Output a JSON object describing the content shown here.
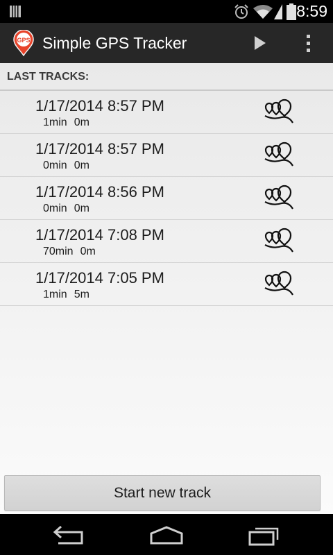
{
  "status_bar": {
    "time": "8:59",
    "icons": [
      "storage-icon",
      "alarm-icon",
      "wifi-icon",
      "signal-icon",
      "battery-icon"
    ]
  },
  "action_bar": {
    "app_icon": "gps-pin-icon",
    "app_icon_text": "GPS",
    "title": "Simple GPS Tracker",
    "actions": [
      "play-icon",
      "overflow-menu-icon"
    ]
  },
  "section_header": "LAST TRACKS:",
  "tracks": [
    {
      "date": "1/17/2014 8:57 PM",
      "duration": "1min",
      "distance": "0m"
    },
    {
      "date": "1/17/2014 8:57 PM",
      "duration": "0min",
      "distance": "0m"
    },
    {
      "date": "1/17/2014 8:56 PM",
      "duration": "0min",
      "distance": "0m"
    },
    {
      "date": "1/17/2014 7:08 PM",
      "duration": "70min",
      "distance": "0m"
    },
    {
      "date": "1/17/2014 7:05 PM",
      "duration": "1min",
      "distance": "5m"
    }
  ],
  "start_button_label": "Start new track",
  "nav_bar": [
    "back-icon",
    "home-icon",
    "recents-icon"
  ],
  "colors": {
    "app_icon_red": "#e8432a",
    "action_bar_bg": "#272727"
  }
}
